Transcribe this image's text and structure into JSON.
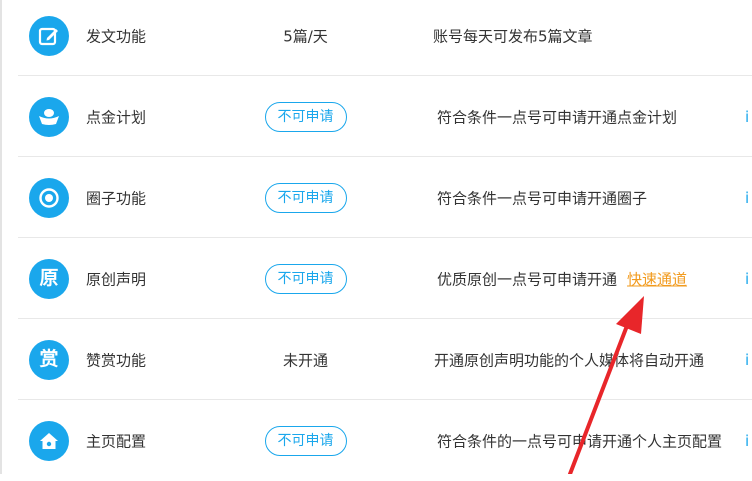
{
  "colors": {
    "accent": "#1aa7ec",
    "link": "#f29b1e",
    "annotation_arrow": "#e8262a",
    "divider": "#e8e8e8",
    "text": "#333333"
  },
  "rows": [
    {
      "name": "发文功能",
      "icon": "edit-icon",
      "status_text": "5篇/天",
      "desc": "账号每天可发布5篇文章"
    },
    {
      "name": "点金计划",
      "icon": "gold-ingot-icon",
      "status_button": "不可申请",
      "desc": "符合条件一点号可申请开通点金计划",
      "edge": "i"
    },
    {
      "name": "圈子功能",
      "icon": "target-circle-icon",
      "status_button": "不可申请",
      "desc": "符合条件一点号可申请开通圈子",
      "edge": "i"
    },
    {
      "name": "原创声明",
      "icon": "original-icon",
      "icon_char": "原",
      "status_button": "不可申请",
      "desc": "优质原创一点号可申请开通",
      "link": "快速通道",
      "edge": "i"
    },
    {
      "name": "赞赏功能",
      "icon": "reward-icon",
      "icon_char": "赏",
      "status_text": "未开通",
      "desc": "开通原创声明功能的个人媒体将自动开通",
      "edge": "i"
    },
    {
      "name": "主页配置",
      "icon": "home-icon",
      "status_button": "不可申请",
      "desc": "符合条件的一点号可申请开通个人主页配置",
      "edge": "i"
    }
  ]
}
